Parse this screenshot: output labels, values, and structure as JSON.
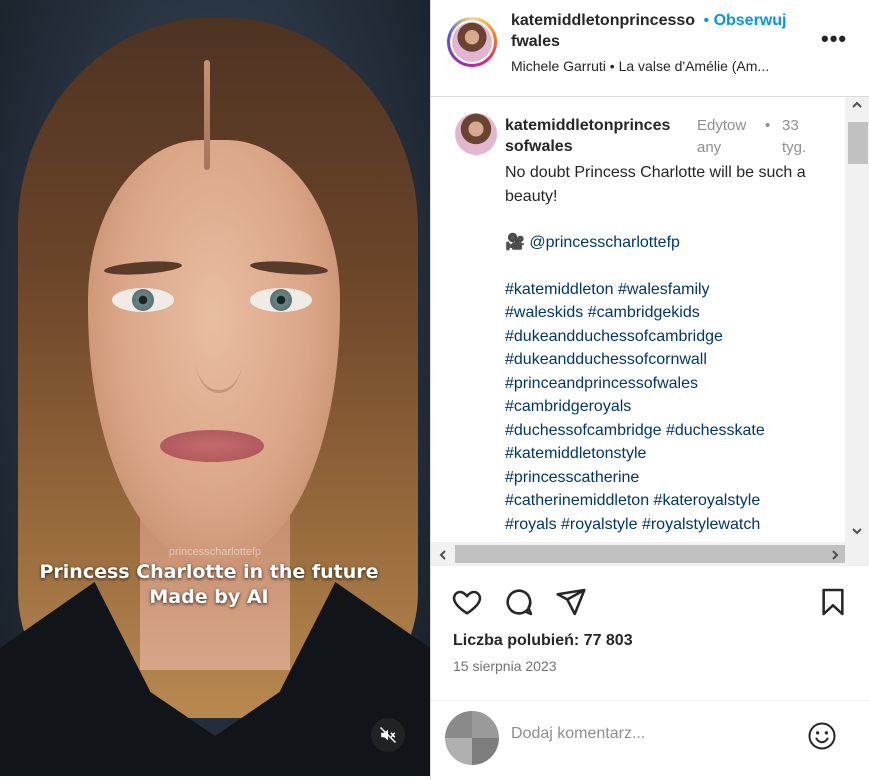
{
  "media": {
    "watermark": "princesscharlottefp",
    "caption_line1": "Princess Charlotte in the future",
    "caption_line2": "Made by AI",
    "mute_icon": "speaker-muted-icon"
  },
  "header": {
    "username_line1": "katemiddletonprincesso",
    "username_line2": "fwales",
    "separator": "•",
    "follow_label": "Obserwuj",
    "more_icon": "ellipsis-icon",
    "audio_text": "Michele Garruti • La valse d'Amélie (Am..."
  },
  "caption": {
    "username_line1": "katemiddletonprinces",
    "username_line2": "sofwales",
    "edited_line1": "Edytow",
    "edited_line2": "any",
    "dot": "•",
    "time_line1": "33",
    "time_line2": "tyg.",
    "text": "No doubt Princess Charlotte will be such a beauty!",
    "mention_emoji": "🎥",
    "mention": "@princesscharlottefp",
    "hashtags": [
      "#katemiddleton #walesfamily",
      "#waleskids #cambridgekids",
      "#dukeandduchessofcambridge",
      "#dukeandduchessofcornwall",
      "#princeandprincessofwales",
      "#cambridgeroyals",
      "#duchessofcambridge #duchesskate",
      "#katemiddletonstyle",
      "#princesscatherine",
      "#catherinemiddleton #kateroyalstyle",
      "#royals #royalstyle #royalstylewatch"
    ]
  },
  "scrollbars": {
    "up": "^",
    "down": "v",
    "left": "<",
    "right": ">"
  },
  "actions": {
    "like_icon": "heart-icon",
    "comment_icon": "comment-icon",
    "share_icon": "paper-plane-icon",
    "save_icon": "bookmark-icon"
  },
  "likes": "Liczba polubień: 77 803",
  "date": "15 sierpnia 2023",
  "composer": {
    "placeholder": "Dodaj komentarz...",
    "emoji_icon": "smiley-icon"
  },
  "colors": {
    "follow": "#0095f6",
    "link": "#00376b",
    "muted_text": "#8e8e8e"
  }
}
